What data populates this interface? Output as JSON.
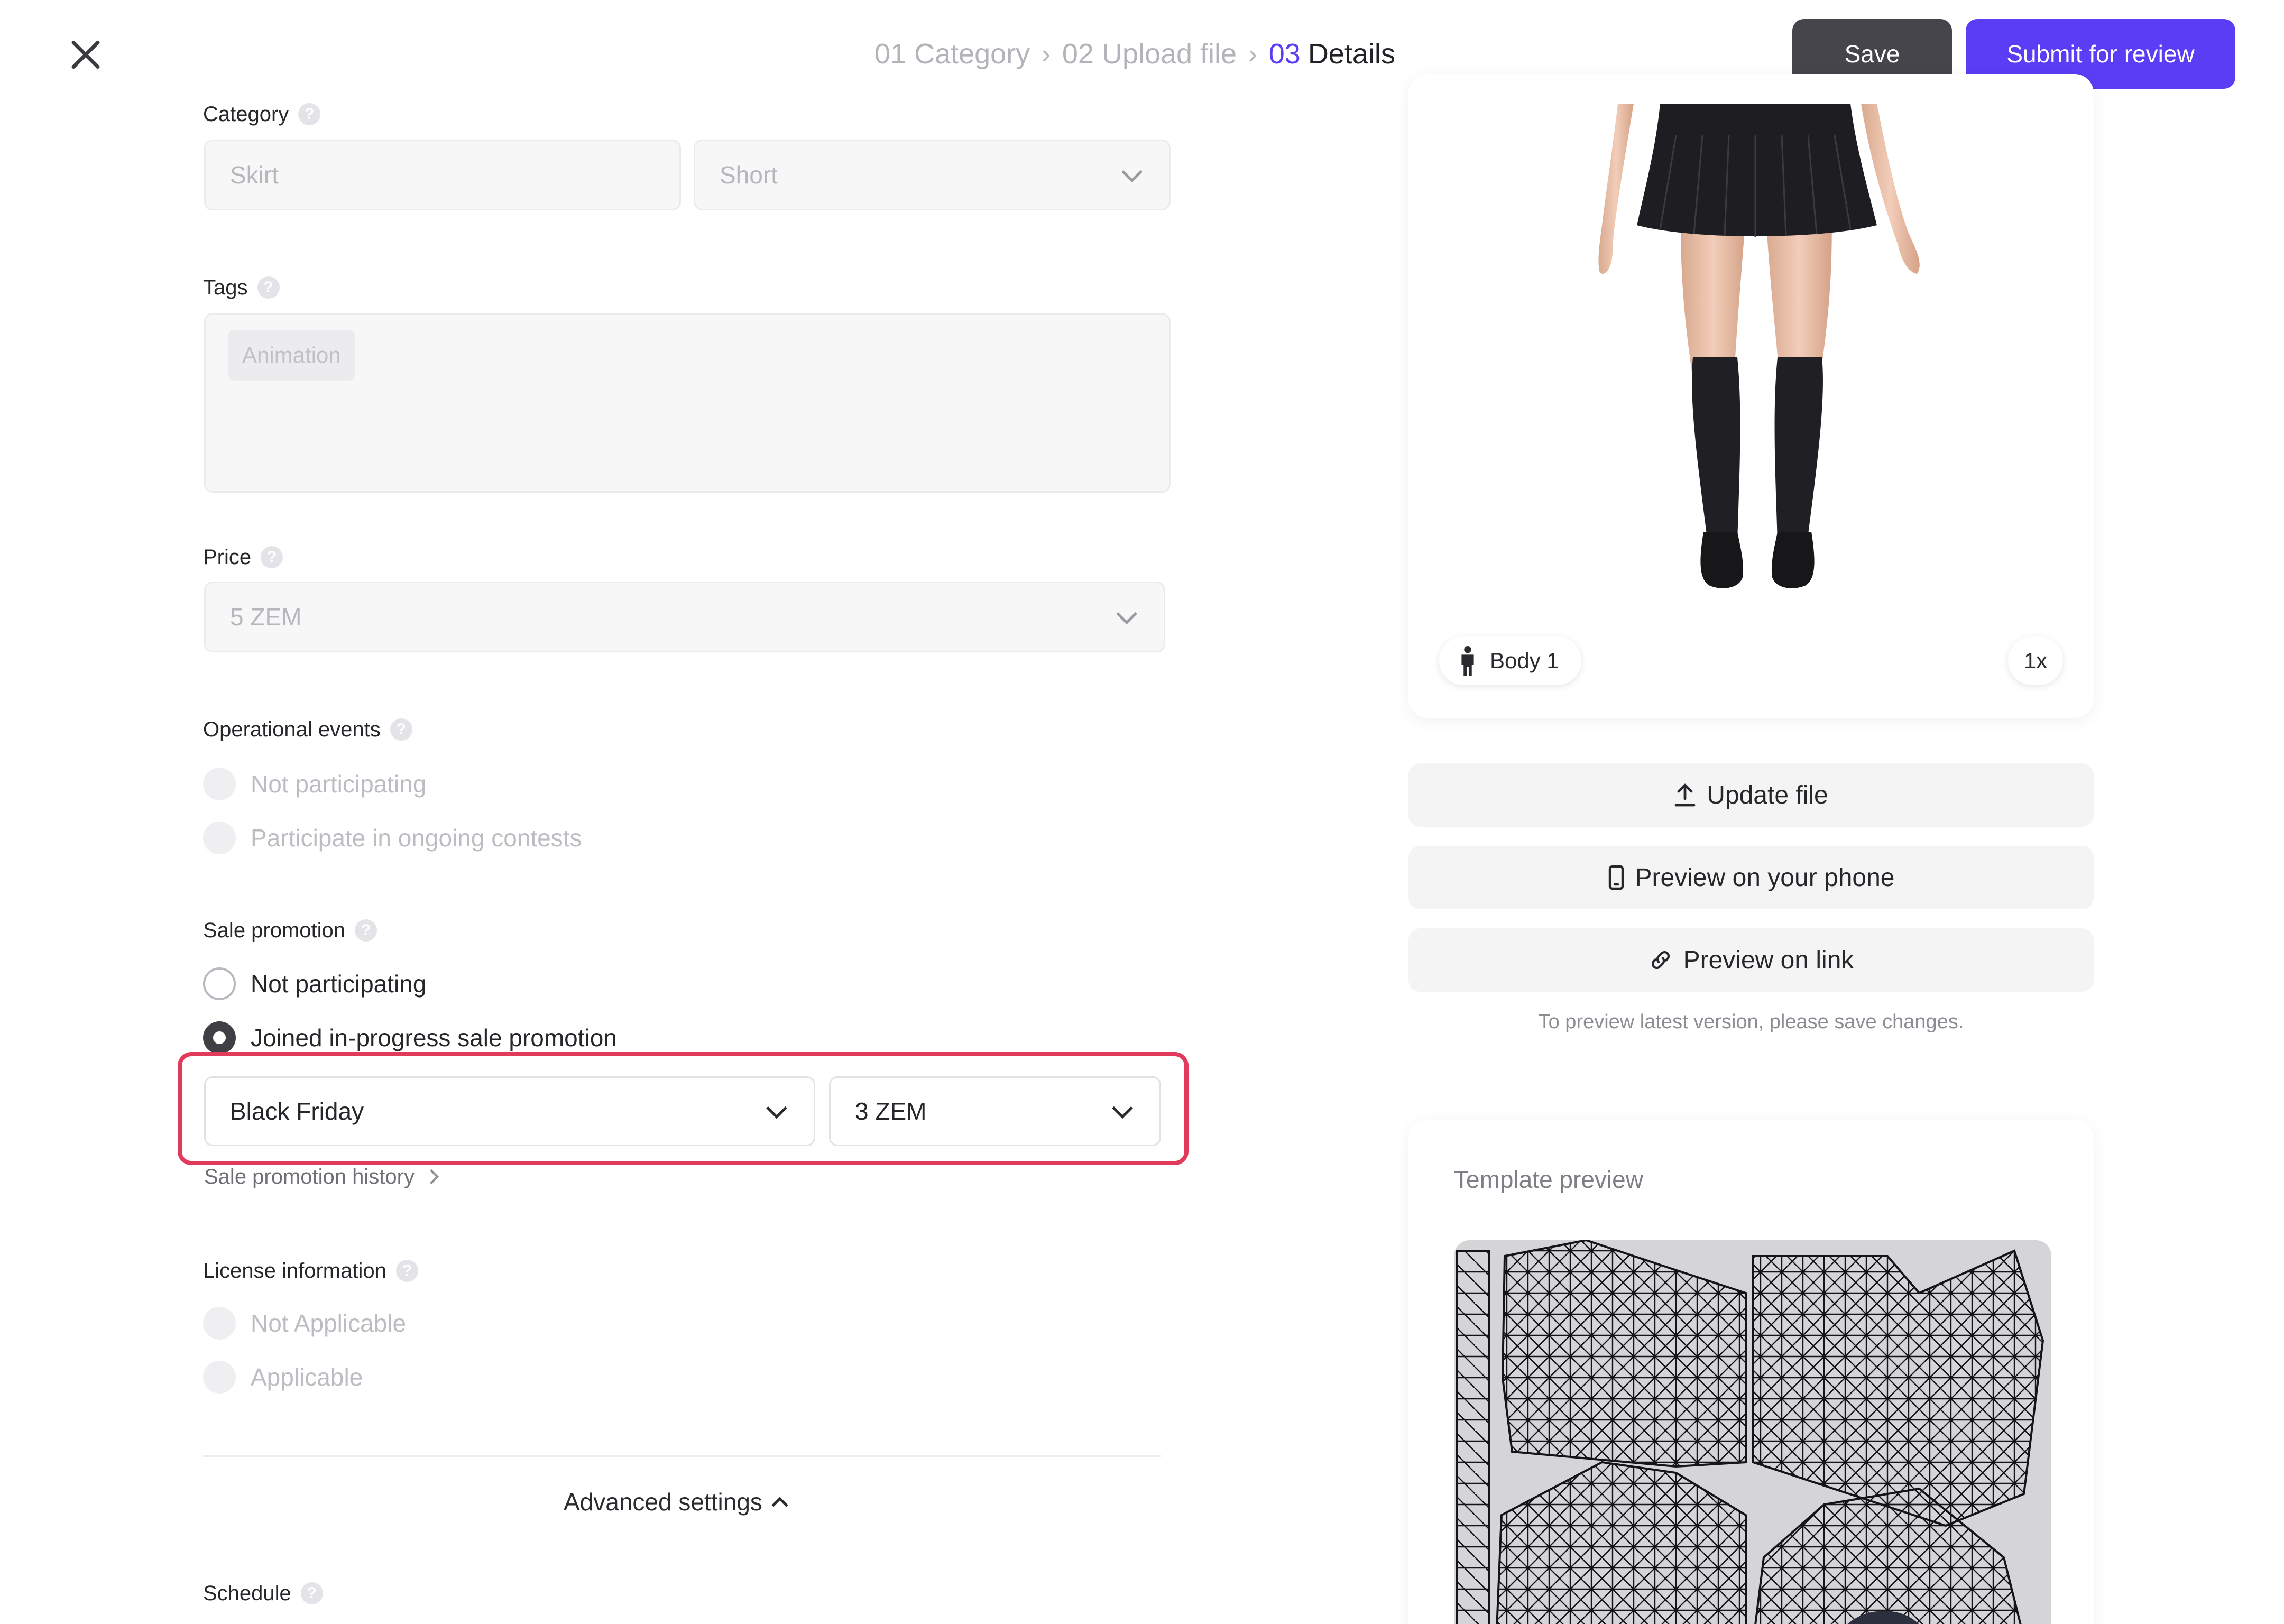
{
  "header": {
    "breadcrumb": [
      {
        "label": "01 Category"
      },
      {
        "label": "02 Upload file"
      }
    ],
    "active_step_number": "03",
    "active_step_label": "Details",
    "save_label": "Save",
    "submit_label": "Submit for review"
  },
  "form": {
    "category": {
      "label": "Category",
      "value_1": "Skirt",
      "value_2": "Short"
    },
    "tags": {
      "label": "Tags",
      "items": [
        "Animation"
      ]
    },
    "price": {
      "label": "Price",
      "value": "5 ZEM"
    },
    "operational_events": {
      "label": "Operational events",
      "options": [
        "Not participating",
        "Participate in ongoing contests"
      ],
      "enabled": false
    },
    "sale_promotion": {
      "label": "Sale promotion",
      "options": [
        "Not participating",
        "Joined in-progress sale promotion"
      ],
      "selected_index": 1,
      "event_value": "Black Friday",
      "price_value": "3 ZEM",
      "history_link": "Sale promotion history"
    },
    "license_information": {
      "label": "License information",
      "options": [
        "Not Applicable",
        "Applicable"
      ],
      "enabled": false
    },
    "advanced_settings_label": "Advanced settings",
    "schedule_label": "Schedule"
  },
  "preview": {
    "body_chip": "Body 1",
    "zoom": "1x",
    "update_file": "Update file",
    "preview_phone": "Preview on your phone",
    "preview_link": "Preview on link",
    "note": "To preview latest version, please save changes.",
    "template_title": "Template preview"
  },
  "colors": {
    "accent": "#5b3df5",
    "save_button": "#45454b",
    "highlight": "#e23a5a"
  },
  "icons": [
    "close-icon",
    "chevron-right-icon",
    "help-icon",
    "chevron-down-icon",
    "chevron-up-icon",
    "person-icon",
    "upload-icon",
    "phone-icon",
    "link-icon"
  ]
}
